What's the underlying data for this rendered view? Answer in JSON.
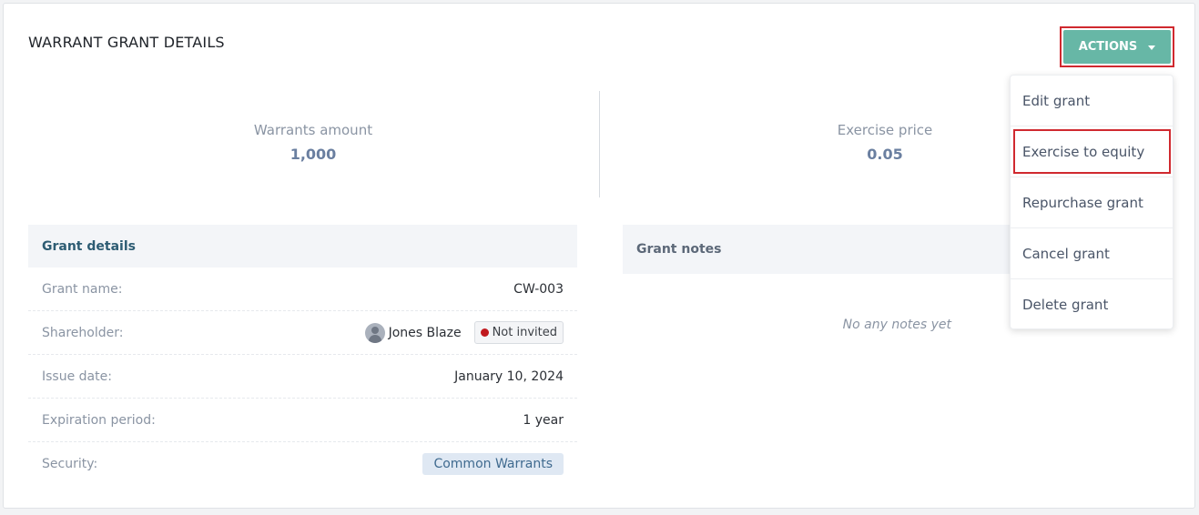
{
  "page": {
    "title": "WARRANT GRANT DETAILS"
  },
  "actions": {
    "label": "ACTIONS",
    "accent": "#67b7a6",
    "highlight_color": "#d0292f"
  },
  "stats": [
    {
      "label": "Warrants amount",
      "value": "1,000"
    },
    {
      "label": "Exercise price",
      "value": "0.05"
    }
  ],
  "details": {
    "header": "Grant details",
    "rows": [
      {
        "key": "Grant name:",
        "value": "CW-003"
      },
      {
        "key": "Shareholder:",
        "value": "Jones Blaze",
        "badge": "Not invited"
      },
      {
        "key": "Issue date:",
        "value": "January 10, 2024"
      },
      {
        "key": "Expiration period:",
        "value": "1 year"
      },
      {
        "key": "Security:",
        "value": "Common Warrants"
      }
    ]
  },
  "notes": {
    "header": "Grant notes",
    "empty": "No any notes yet"
  },
  "menu": {
    "items": [
      {
        "label": "Edit grant"
      },
      {
        "label": "Exercise to equity",
        "highlighted": true
      },
      {
        "label": "Repurchase grant"
      },
      {
        "label": "Cancel grant"
      },
      {
        "label": "Delete grant"
      }
    ]
  },
  "icons": {
    "avatar": "user-avatar-icon",
    "status_dot": "red-dot-icon",
    "caret": "caret-down-icon"
  }
}
